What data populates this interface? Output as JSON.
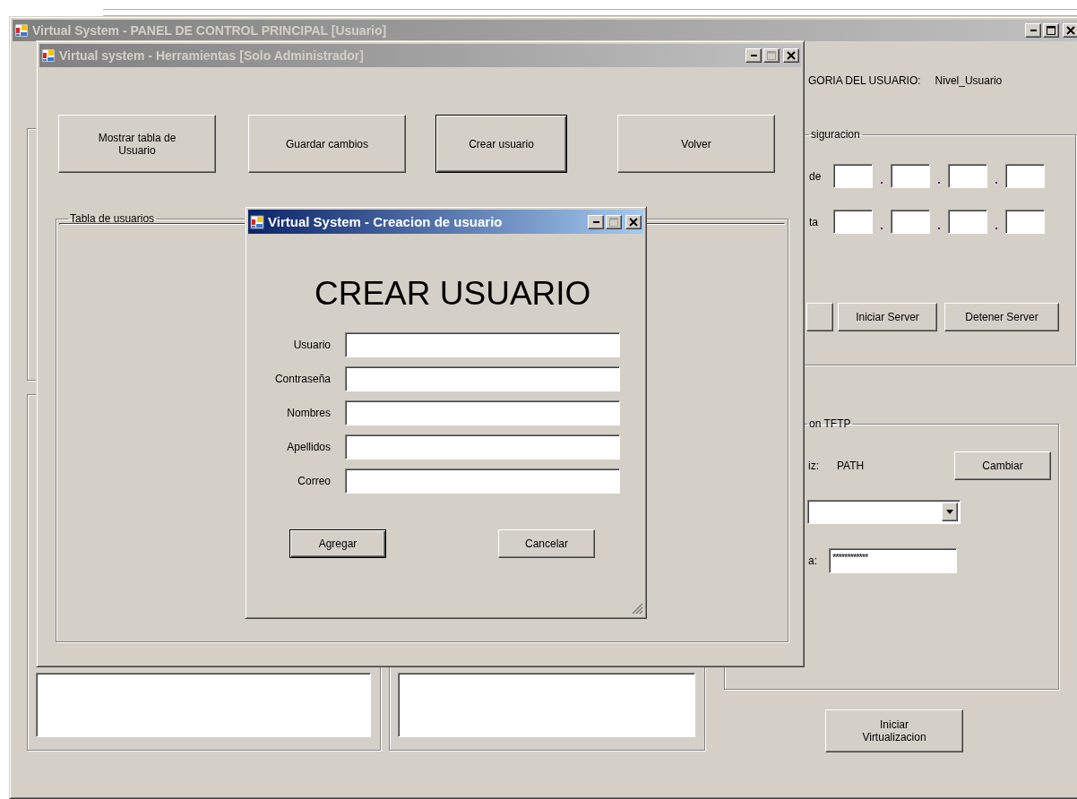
{
  "main_window": {
    "title": "Virtual System - PANEL DE CONTROL PRINCIPAL [Usuario]",
    "active": false,
    "maximize_enabled": true,
    "category": {
      "label": "GORIA DEL USUARIO:",
      "value": "Nivel_Usuario"
    },
    "config_group": {
      "legend": "siguracion",
      "ip_rows": [
        {
          "label": "de"
        },
        {
          "label": "ta"
        }
      ],
      "buttons": [
        "Iniciar Server",
        "Detener Server"
      ]
    },
    "tftp_group": {
      "legend": "on TFTP",
      "root_label": "iz:",
      "root_value": "PATH",
      "change_button": "Cambiar",
      "password_label": "a:",
      "password_value": "************"
    },
    "start_button": "Iniciar Virtualizacion"
  },
  "tools_window": {
    "title": "Virtual system - Herramientas [Solo Administrador]",
    "active": false,
    "maximize_enabled": false,
    "buttons": [
      {
        "label": "Mostrar tabla de Usuario",
        "focused": false
      },
      {
        "label": "Guardar cambios",
        "focused": false
      },
      {
        "label": "Crear usuario",
        "focused": true
      },
      {
        "label": "Volver",
        "focused": false
      }
    ],
    "table_legend": "Tabla de usuarios"
  },
  "dialog": {
    "title": "Virtual System - Creacion de usuario",
    "active": true,
    "maximize_enabled": false,
    "heading": "CREAR USUARIO",
    "fields": [
      {
        "label": "Usuario"
      },
      {
        "label": "Contraseña"
      },
      {
        "label": "Nombres"
      },
      {
        "label": "Apellidos"
      },
      {
        "label": "Correo"
      }
    ],
    "buttons": [
      {
        "label": "Agregar",
        "default": true
      },
      {
        "label": "Cancelar",
        "default": false
      }
    ]
  }
}
